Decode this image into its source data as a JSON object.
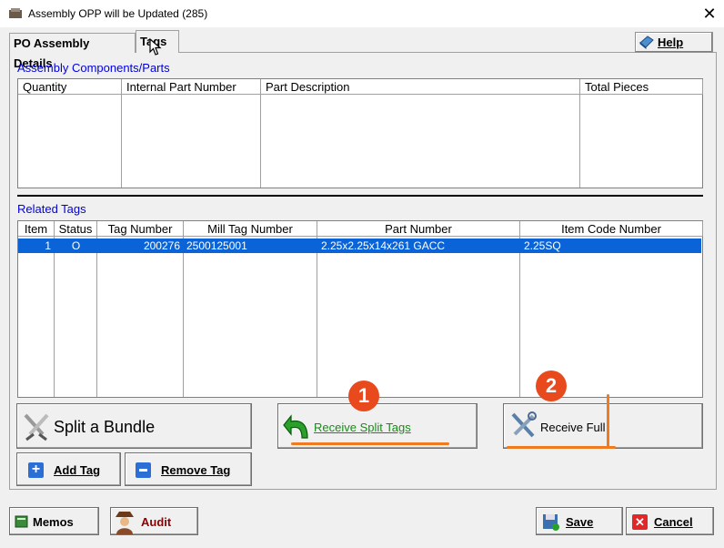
{
  "window": {
    "title": "Assembly OPP will be Updated  (285)",
    "close_glyph": "✕"
  },
  "tabs": [
    {
      "label": "PO Assembly Details",
      "active": false
    },
    {
      "label": "Tags",
      "active": true
    }
  ],
  "help": {
    "label": "Help",
    "icon": "book-icon"
  },
  "components": {
    "section_label": "Assembly Components/Parts",
    "columns": [
      "Quantity",
      "Internal Part Number",
      "Part Description",
      "Total Pieces"
    ],
    "rows": []
  },
  "related_tags": {
    "section_label": "Related Tags",
    "columns": [
      "Item",
      "Status",
      "Tag Number",
      "Mill Tag Number",
      "Part Number",
      "Item Code Number"
    ],
    "rows": [
      {
        "item": "1",
        "status": "O",
        "tag_number": "200276",
        "mill_tag_number": "2500125001",
        "part_number": "2.25x2.25x14x261 GACC",
        "item_code_number": "2.25SQ",
        "selected": true
      }
    ],
    "selected_color": "#0a64d8"
  },
  "actions": {
    "split_bundle": "Split a Bundle",
    "add_tag": "Add Tag",
    "remove_tag": "Remove Tag",
    "receive_split": "Receive Split Tags",
    "receive_full": "Receive Full"
  },
  "annotations": {
    "badge_1": "1",
    "badge_2": "2",
    "color": "#e84a1e"
  },
  "footer": {
    "memos": "Memos",
    "audit": "Audit",
    "save": "Save",
    "cancel": "Cancel"
  },
  "colors": {
    "receive_split_text": "#1a8a1a",
    "audit_text": "#8b0000",
    "section_label": "#0000e0"
  }
}
